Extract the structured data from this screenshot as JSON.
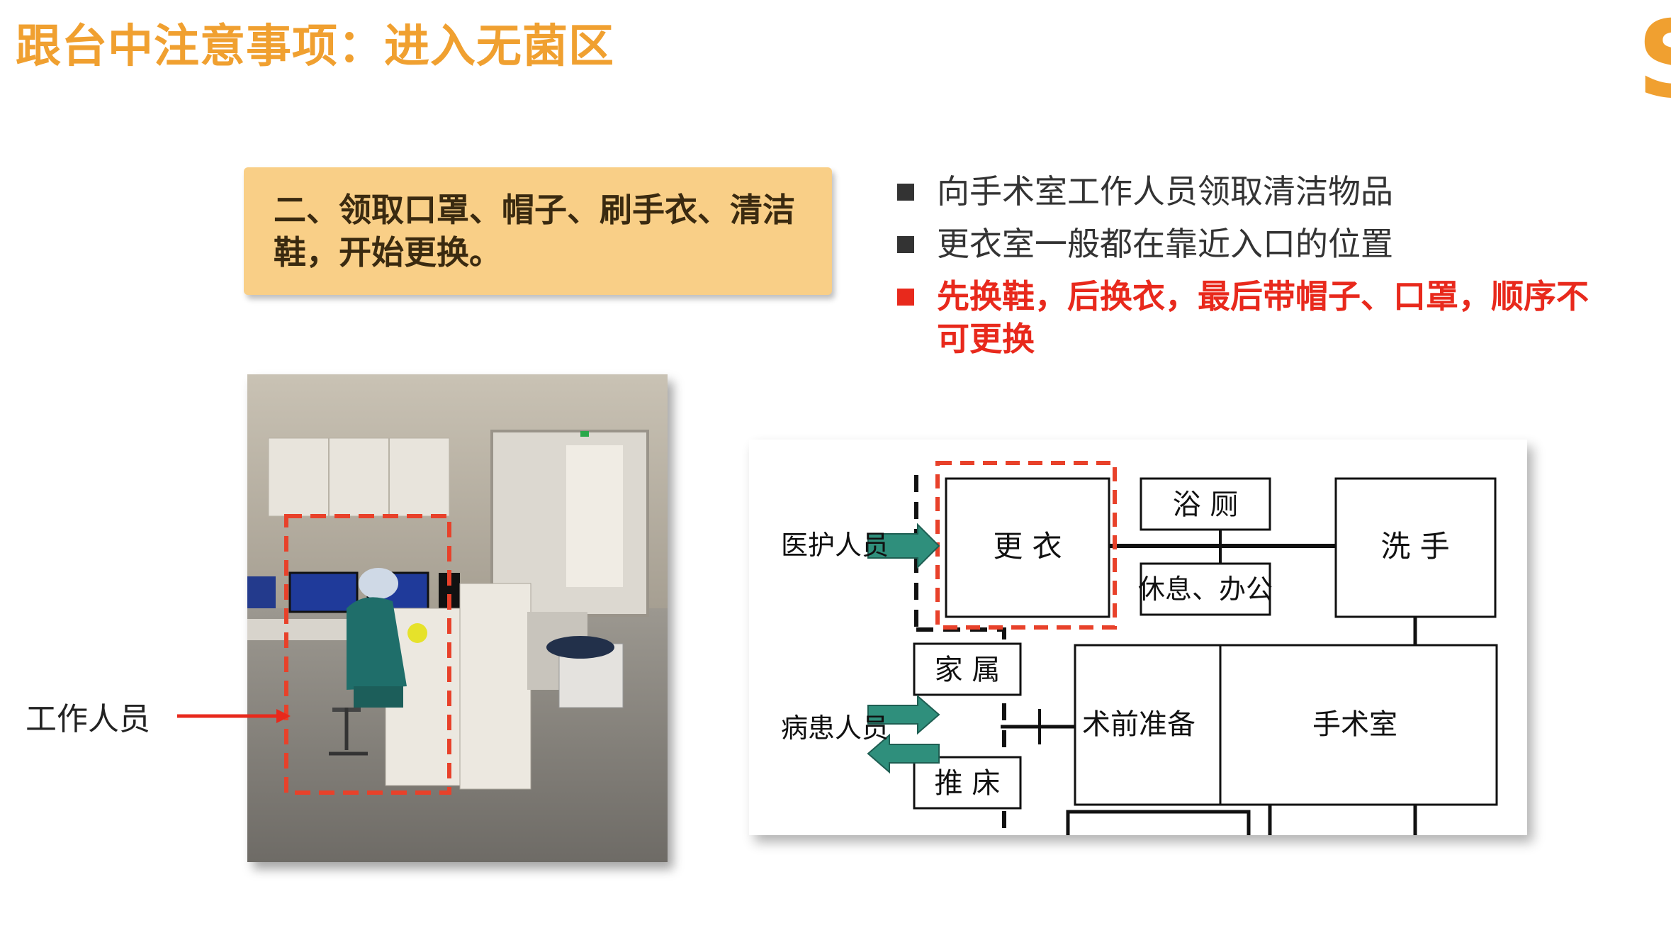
{
  "slide": {
    "title": "跟台中注意事项：进入无菌区",
    "brand_letter": "S",
    "accent_color": "#f0a030"
  },
  "callout": {
    "text": "二、领取口罩、帽子、刷手衣、清洁鞋，开始更换。"
  },
  "bullets": [
    {
      "text": "向手术室工作人员领取清洁物品",
      "color": "#333333"
    },
    {
      "text": "更衣室一般都在靠近入口的位置",
      "color": "#333333"
    },
    {
      "text": "先换鞋，后换衣，最后带帽子、口罩，顺序不可更换",
      "color": "#e8291c"
    }
  ],
  "photo": {
    "label": "工作人员"
  },
  "diagram": {
    "medical_staff": "医护人员",
    "changing_room": "更 衣",
    "bath_toilet": "浴 厕",
    "rest_office": "休息、办公",
    "hand_wash": "洗 手",
    "family": "家 属",
    "patient_staff": "病患人员",
    "stretcher": "推 床",
    "pre_op": "术前准备",
    "operating_room": "手术室"
  }
}
